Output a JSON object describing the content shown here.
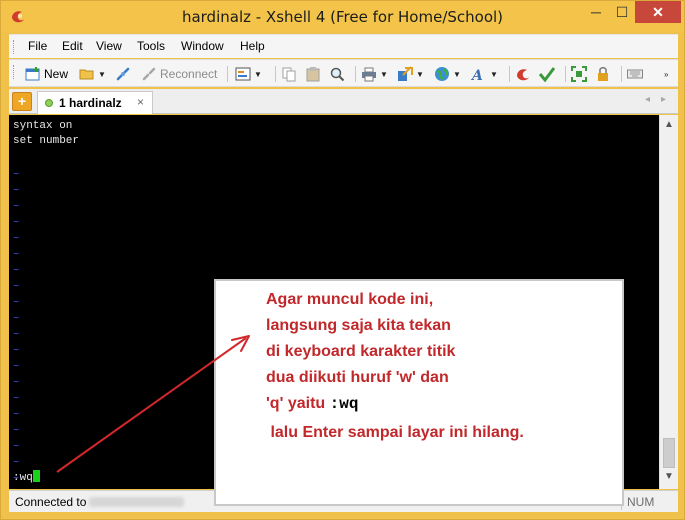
{
  "window": {
    "title": "hardinalz - Xshell 4 (Free for Home/School)",
    "controls": {
      "minimize": "─",
      "maximize": "☐",
      "close": "✕"
    }
  },
  "menu": {
    "items": [
      "File",
      "Edit",
      "View",
      "Tools",
      "Window",
      "Help"
    ]
  },
  "toolbar": {
    "new_label": "New",
    "reconnect_label": "Reconnect",
    "icons": [
      "new-session-icon",
      "open-folder-icon",
      "connect-icon",
      "reconnect-icon",
      "properties-icon",
      "copy-icon",
      "paste-icon",
      "find-icon",
      "print-icon",
      "transfer-icon",
      "globe-icon",
      "font-icon",
      "xshell-icon",
      "xftp-icon",
      "fullscreen-icon",
      "lock-icon",
      "keyboard-icon"
    ]
  },
  "tabs": {
    "add_label": "+",
    "items": [
      {
        "label": "1 hardinalz",
        "close": "×"
      }
    ],
    "nav_left": "◂",
    "nav_right": "▸"
  },
  "terminal": {
    "lines": [
      "syntax on",
      "set number"
    ],
    "tilde": "~",
    "command": ":wq"
  },
  "status": {
    "connected_prefix": "Connected to",
    "num": "NUM"
  },
  "callout": {
    "lines": [
      "Agar muncul kode ini,",
      "langsung saja kita tekan",
      "di keyboard karakter titik",
      "dua diikuti huruf 'w' dan",
      "'q' yaitu ",
      " lalu Enter sampai layar ini hilang."
    ],
    "code": ":wq"
  },
  "colors": {
    "title_bar": "#f3c449",
    "terminal_bg": "#000000",
    "tilde": "#4050ff",
    "cursor": "#18d318",
    "annotation": "#c1282b"
  }
}
